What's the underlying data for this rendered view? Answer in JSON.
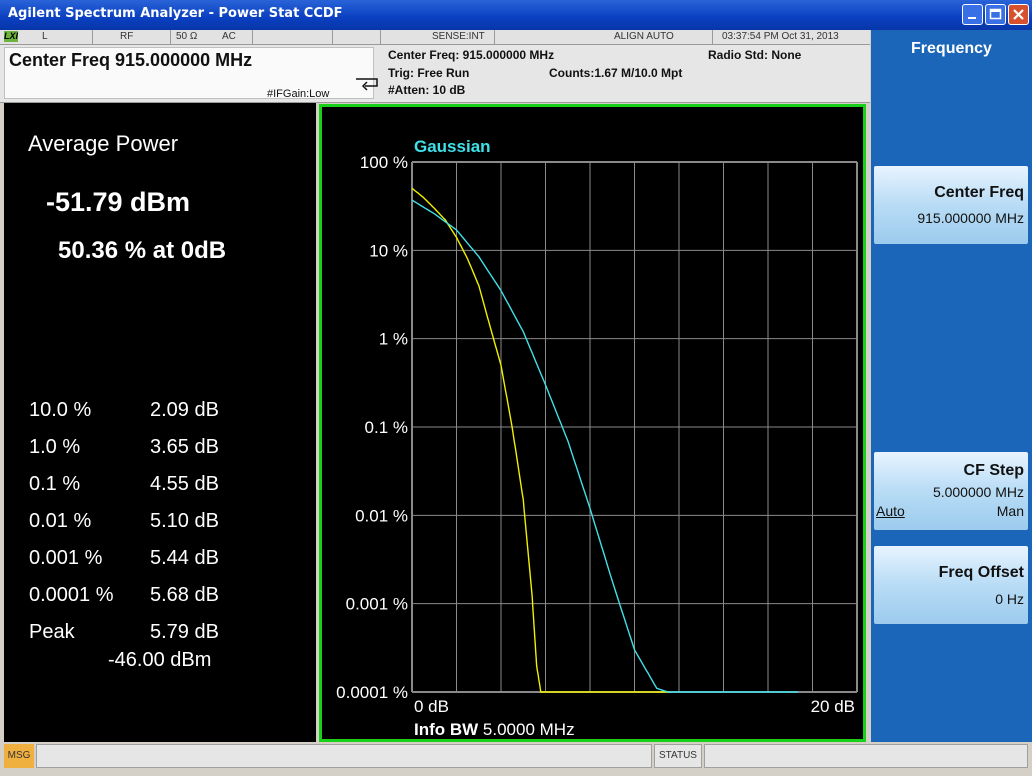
{
  "window": {
    "title": "Agilent Spectrum Analyzer - Power Stat CCDF",
    "icons": [
      "minimize-icon",
      "maximize-icon",
      "close-icon"
    ]
  },
  "status_strip": {
    "lxi": "LXI",
    "mode": "L",
    "input": "RF",
    "impedance": "50 Ω",
    "coupling": "AC",
    "sense": "SENSE:INT",
    "align": "ALIGN AUTO",
    "datetime": "03:37:54 PM Oct 31, 2013"
  },
  "measurement_bar": {
    "center_freq_title": "Center Freq 915.000000 MHz",
    "if_gain": "#IFGain:Low",
    "center_freq": "Center Freq: 915.000000 MHz",
    "trig": "Trig: Free Run",
    "atten": "#Atten: 10 dB",
    "radio_std": "Radio Std: None",
    "counts": "Counts:1.67 M/10.0 Mpt"
  },
  "results": {
    "title": "Average Power",
    "avg_dbm": "-51.79 dBm",
    "avg_pct": "50.36 % at 0dB",
    "rows": [
      {
        "label": "10.0 %",
        "value": "2.09 dB"
      },
      {
        "label": "1.0 %",
        "value": "3.65 dB"
      },
      {
        "label": "0.1 %",
        "value": "4.55 dB"
      },
      {
        "label": "0.01 %",
        "value": "5.10 dB"
      },
      {
        "label": "0.001 %",
        "value": "5.44 dB"
      },
      {
        "label": "0.0001 %",
        "value": "5.68 dB"
      },
      {
        "label": "Peak",
        "value": "5.79 dB"
      }
    ],
    "peak_dbm": "-46.00 dBm"
  },
  "graph": {
    "legend_gaussian": "Gaussian",
    "x_start": "0 dB",
    "x_end": "20 dB",
    "info_bw_label": "Info BW",
    "info_bw_value": "5.0000 MHz",
    "y_ticks": [
      "100 %",
      "10 %",
      "1 %",
      "0.1 %",
      "0.01 %",
      "0.001 %",
      "0.0001 %"
    ],
    "colors": {
      "measured": "#f0f000",
      "gaussian": "#40e0e8",
      "border": "#19d019",
      "grid": "#8a8a8a"
    }
  },
  "chart_data": {
    "type": "line",
    "xlabel": "",
    "ylabel": "",
    "xlim": [
      0,
      20
    ],
    "ylim_percent": [
      0.0001,
      100
    ],
    "y_scale": "log",
    "series": [
      {
        "name": "",
        "color": "#f0f000",
        "x": [
          0,
          0.5,
          1,
          1.5,
          2,
          2.5,
          3,
          3.5,
          4,
          4.5,
          5,
          5.4,
          5.6,
          5.79
        ],
        "y_percent": [
          50.36,
          40,
          30,
          22,
          14,
          8,
          4,
          1.4,
          0.5,
          0.1,
          0.015,
          0.0012,
          0.0002,
          0.0001
        ]
      },
      {
        "name": "Gaussian",
        "color": "#40e0e8",
        "x": [
          0,
          1,
          2,
          3,
          4,
          5,
          6,
          7,
          8,
          9,
          10,
          11,
          11.5
        ],
        "y_percent": [
          37,
          26,
          17,
          8.5,
          3.5,
          1.2,
          0.3,
          0.07,
          0.012,
          0.0018,
          0.0003,
          0.00011,
          0.0001
        ]
      }
    ],
    "grid": true
  },
  "softkeys": {
    "menu_title": "Frequency",
    "center_freq_label": "Center Freq",
    "center_freq_value": "915.000000 MHz",
    "cf_step_label": "CF Step",
    "cf_step_value": "5.000000 MHz",
    "cf_step_auto": "Auto",
    "cf_step_man": "Man",
    "freq_offset_label": "Freq Offset",
    "freq_offset_value": "0 Hz"
  },
  "bottom_bar": {
    "msg": "MSG",
    "status": "STATUS"
  }
}
